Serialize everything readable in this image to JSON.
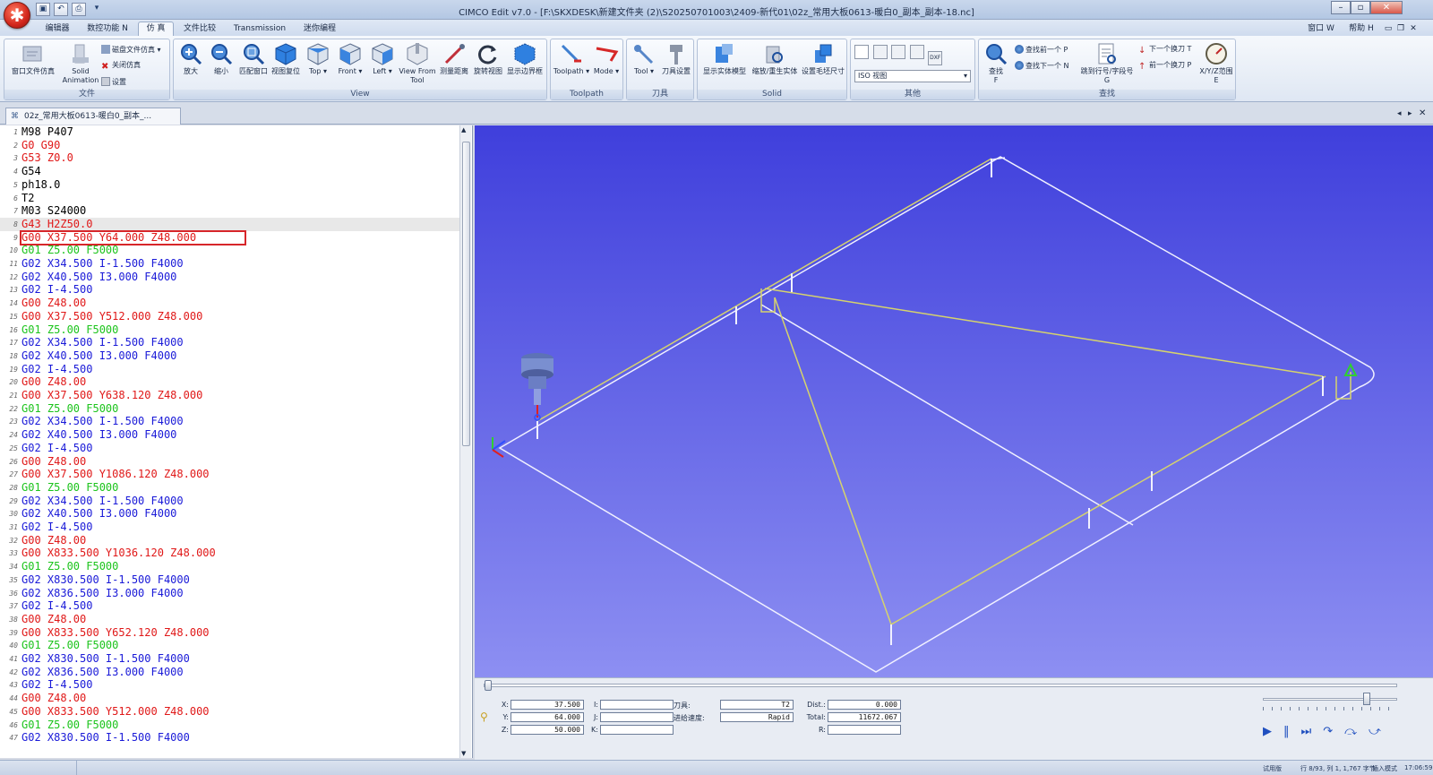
{
  "window": {
    "title": "CIMCO Edit v7.0 - [F:\\SKXDESK\\新建文件夹 (2)\\S20250701003\\2409-新代01\\02z_常用大板0613-暖白0_副本_副本-18.nc]",
    "right_menu": {
      "window": "窗口 W",
      "help": "帮助 H"
    }
  },
  "menu_tabs": [
    "编辑器",
    "数控功能 N",
    "仿 真",
    "文件比较",
    "Transmission",
    "迷你编程"
  ],
  "ribbon": {
    "file_group": {
      "label": "文件",
      "window_sim": "窗口文件仿真",
      "solid_anim_1": "Solid",
      "solid_anim_2": "Animation",
      "disk_sim": "磁盘文件仿真",
      "close_sim": "关闭仿真",
      "settings": "设置"
    },
    "view_group": {
      "label": "View",
      "zoom_in": "放大",
      "zoom_out": "缩小",
      "fit": "匹配窗口",
      "reset": "视图复位",
      "top": "Top",
      "front": "Front",
      "left": "Left",
      "from_tool_1": "View From",
      "from_tool_2": "Tool",
      "measure": "测量距离",
      "rotate": "旋转视图",
      "bounds": "显示边界框"
    },
    "toolpath_group": {
      "label": "Toolpath",
      "toolpath": "Toolpath",
      "mode": "Mode"
    },
    "tool_group": {
      "label": "刀具",
      "tool": "Tool",
      "tool_settings": "刀具设置"
    },
    "solid_group": {
      "label": "Solid",
      "show_solid": "显示实体模型",
      "zoom_regen": "缩放/重生实体",
      "stock_size": "设置毛坯尺寸"
    },
    "other_group": {
      "label": "其他",
      "iso_value": "ISO 视图"
    },
    "find_group": {
      "label": "查找",
      "find_1": "查找",
      "find_2": "F",
      "find_prev": "查找前一个 P",
      "find_next": "查找下一个 N",
      "goto_1": "跳到行号/字段号",
      "goto_2": "G",
      "next_tool": "下一个换刀 T",
      "prev_tool": "前一个换刀 P",
      "xyz_1": "X/Y/Z范围",
      "xyz_2": "E"
    }
  },
  "doc_tab": {
    "label": "02z_常用大板0613-暖白0_副本_..."
  },
  "editor": {
    "lines": [
      {
        "n": "1",
        "t": "M98 P407"
      },
      {
        "n": "2",
        "t": "G0 G90"
      },
      {
        "n": "3",
        "t": "G53 Z0.0"
      },
      {
        "n": "4",
        "t": "G54"
      },
      {
        "n": "5",
        "t": "ph18.0"
      },
      {
        "n": "6",
        "t": "T2"
      },
      {
        "n": "7",
        "t": "M03 S24000"
      },
      {
        "n": "8",
        "t": "G43 H2Z50.0"
      },
      {
        "n": "9",
        "t": "G00 X37.500 Y64.000 Z48.000"
      },
      {
        "n": "10",
        "t": "G01 Z5.00 F5000"
      },
      {
        "n": "11",
        "t": "G02 X34.500 I-1.500 F4000"
      },
      {
        "n": "12",
        "t": "G02 X40.500 I3.000 F4000"
      },
      {
        "n": "13",
        "t": "G02 I-4.500"
      },
      {
        "n": "14",
        "t": "G00 Z48.00"
      },
      {
        "n": "15",
        "t": "G00 X37.500 Y512.000 Z48.000"
      },
      {
        "n": "16",
        "t": "G01 Z5.00 F5000"
      },
      {
        "n": "17",
        "t": "G02 X34.500 I-1.500 F4000"
      },
      {
        "n": "18",
        "t": "G02 X40.500 I3.000 F4000"
      },
      {
        "n": "19",
        "t": "G02 I-4.500"
      },
      {
        "n": "20",
        "t": "G00 Z48.00"
      },
      {
        "n": "21",
        "t": "G00 X37.500 Y638.120 Z48.000"
      },
      {
        "n": "22",
        "t": "G01 Z5.00 F5000"
      },
      {
        "n": "23",
        "t": "G02 X34.500 I-1.500 F4000"
      },
      {
        "n": "24",
        "t": "G02 X40.500 I3.000 F4000"
      },
      {
        "n": "25",
        "t": "G02 I-4.500"
      },
      {
        "n": "26",
        "t": "G00 Z48.00"
      },
      {
        "n": "27",
        "t": "G00 X37.500 Y1086.120 Z48.000"
      },
      {
        "n": "28",
        "t": "G01 Z5.00 F5000"
      },
      {
        "n": "29",
        "t": "G02 X34.500 I-1.500 F4000"
      },
      {
        "n": "30",
        "t": "G02 X40.500 I3.000 F4000"
      },
      {
        "n": "31",
        "t": "G02 I-4.500"
      },
      {
        "n": "32",
        "t": "G00 Z48.00"
      },
      {
        "n": "33",
        "t": "G00 X833.500 Y1036.120 Z48.000"
      },
      {
        "n": "34",
        "t": "G01 Z5.00 F5000"
      },
      {
        "n": "35",
        "t": "G02 X830.500 I-1.500 F4000"
      },
      {
        "n": "36",
        "t": "G02 X836.500 I3.000 F4000"
      },
      {
        "n": "37",
        "t": "G02 I-4.500"
      },
      {
        "n": "38",
        "t": "G00 Z48.00"
      },
      {
        "n": "39",
        "t": "G00 X833.500 Y652.120 Z48.000"
      },
      {
        "n": "40",
        "t": "G01 Z5.00 F5000"
      },
      {
        "n": "41",
        "t": "G02 X830.500 I-1.500 F4000"
      },
      {
        "n": "42",
        "t": "G02 X836.500 I3.000 F4000"
      },
      {
        "n": "43",
        "t": "G02 I-4.500"
      },
      {
        "n": "44",
        "t": "G00 Z48.00"
      },
      {
        "n": "45",
        "t": "G00 X833.500 Y512.000 Z48.000"
      },
      {
        "n": "46",
        "t": "G01 Z5.00 F5000"
      },
      {
        "n": "47",
        "t": "G02 X830.500 I-1.500 F4000"
      }
    ],
    "current_line": "8",
    "selected_line": "9"
  },
  "readout": {
    "x_label": "X:",
    "x_value": "37.500",
    "y_label": "Y:",
    "y_value": "64.000",
    "z_label": "Z:",
    "z_value": "50.000",
    "i_label": "I:",
    "j_label": "J:",
    "k_label": "K:",
    "tool_label": "刀具:",
    "tool_value": "T2",
    "feed_label": "进给速度:",
    "feed_value": "Rapid",
    "dist_label": "Dist.:",
    "dist_value": "0.000",
    "total_label": "Total:",
    "total_value": "11672.067",
    "r_label": "R:"
  },
  "playback": {
    "speed_fraction": 0.78,
    "progress_fraction": 0.0
  },
  "status": {
    "mode": "试用版",
    "position": "行 8/93, 列 1, 1,767 字节",
    "insert": "插入模式",
    "time": "17:06:59"
  },
  "colors": {
    "code_red": "#e01818",
    "code_green": "#1cc41c",
    "code_blue": "#1a1ad8",
    "code_black": "#000000",
    "viewport_top": "#3f3fdc",
    "viewport_bottom": "#8d8ff2",
    "toolpath_yellow": "#d6d36c",
    "outline_white": "#f0f0ff",
    "selection_red": "#d7262a"
  }
}
